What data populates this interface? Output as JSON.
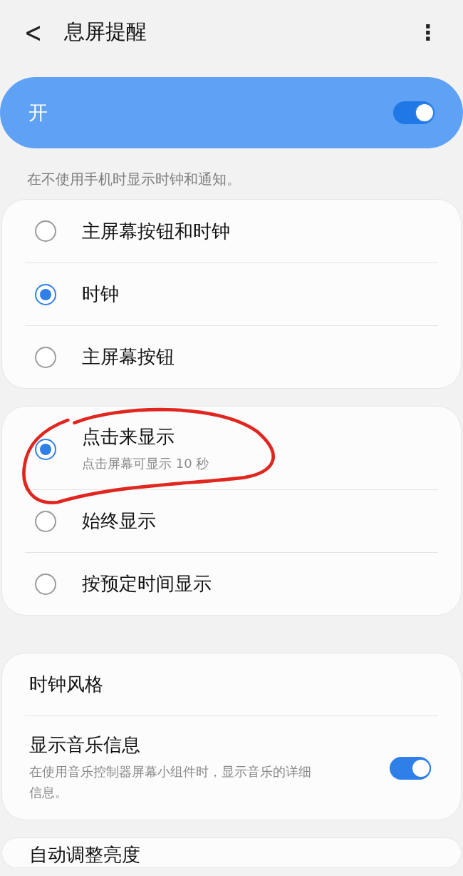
{
  "header": {
    "back": "<",
    "title": "息屏提醒",
    "menu": "⋮"
  },
  "master": {
    "label": "开",
    "on": true
  },
  "description": "在不使用手机时显示时钟和通知。",
  "groups": [
    {
      "kind": "radio",
      "items": [
        {
          "label": "主屏幕按钮和时钟",
          "selected": false
        },
        {
          "label": "时钟",
          "selected": true
        },
        {
          "label": "主屏幕按钮",
          "selected": false
        }
      ]
    },
    {
      "kind": "radio",
      "items": [
        {
          "label": "点击来显示",
          "summary": "点击屏幕可显示 10 秒",
          "selected": true,
          "circled": true
        },
        {
          "label": "始终显示",
          "selected": false,
          "circled": false
        },
        {
          "label": "按预定时间显示",
          "selected": false,
          "circled": false
        }
      ]
    },
    {
      "kind": "settings",
      "items": [
        {
          "kind": "plain",
          "label": "时钟风格"
        },
        {
          "kind": "switch",
          "label": "显示音乐信息",
          "summary": "在使用音乐控制器屏幕小组件时，显示音乐的详细信息。",
          "on": true
        }
      ]
    },
    {
      "kind": "settings",
      "items": [
        {
          "kind": "plain",
          "label": "自动调整亮度"
        }
      ]
    }
  ]
}
